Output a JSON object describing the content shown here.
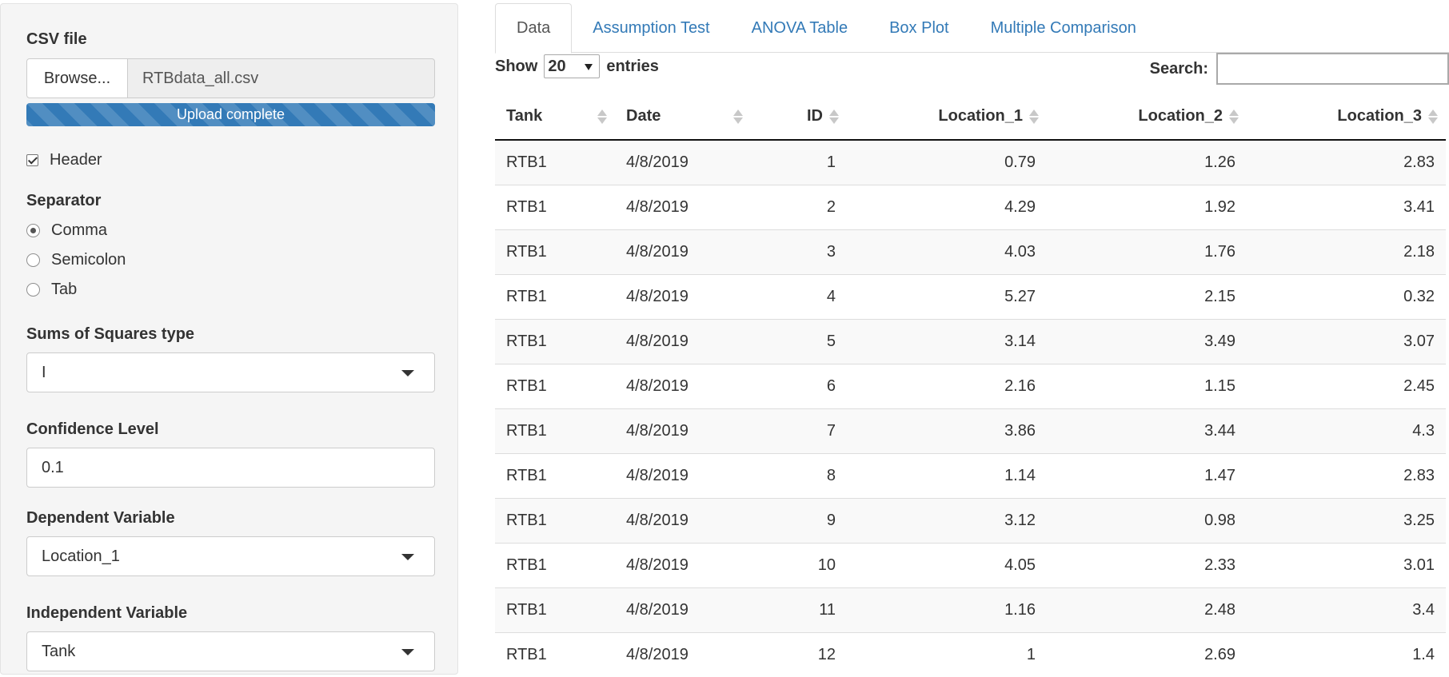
{
  "sidebar": {
    "csv_label": "CSV file",
    "browse_label": "Browse...",
    "file_name": "RTBdata_all.csv",
    "upload_status": "Upload complete",
    "upload_progress_percent": 100,
    "header_label": "Header",
    "header_checked": true,
    "separator_label": "Separator",
    "separator_options": [
      {
        "label": "Comma",
        "checked": true
      },
      {
        "label": "Semicolon",
        "checked": false
      },
      {
        "label": "Tab",
        "checked": false
      }
    ],
    "ss_type_label": "Sums of Squares type",
    "ss_type_value": "I",
    "confidence_label": "Confidence Level",
    "confidence_value": "0.1",
    "dependent_label": "Dependent Variable",
    "dependent_value": "Location_1",
    "independent_label": "Independent Variable",
    "independent_value": "Tank"
  },
  "tabs": [
    {
      "label": "Data",
      "active": true
    },
    {
      "label": "Assumption Test",
      "active": false
    },
    {
      "label": "ANOVA Table",
      "active": false
    },
    {
      "label": "Box Plot",
      "active": false
    },
    {
      "label": "Multiple Comparison",
      "active": false
    }
  ],
  "table_controls": {
    "show_label": "Show",
    "entries_value": "20",
    "entries_label": "entries",
    "search_label": "Search:"
  },
  "table": {
    "columns": [
      "Tank",
      "Date",
      "ID",
      "Location_1",
      "Location_2",
      "Location_3"
    ],
    "rows": [
      [
        "RTB1",
        "4/8/2019",
        "1",
        "0.79",
        "1.26",
        "2.83"
      ],
      [
        "RTB1",
        "4/8/2019",
        "2",
        "4.29",
        "1.92",
        "3.41"
      ],
      [
        "RTB1",
        "4/8/2019",
        "3",
        "4.03",
        "1.76",
        "2.18"
      ],
      [
        "RTB1",
        "4/8/2019",
        "4",
        "5.27",
        "2.15",
        "0.32"
      ],
      [
        "RTB1",
        "4/8/2019",
        "5",
        "3.14",
        "3.49",
        "3.07"
      ],
      [
        "RTB1",
        "4/8/2019",
        "6",
        "2.16",
        "1.15",
        "2.45"
      ],
      [
        "RTB1",
        "4/8/2019",
        "7",
        "3.86",
        "3.44",
        "4.3"
      ],
      [
        "RTB1",
        "4/8/2019",
        "8",
        "1.14",
        "1.47",
        "2.83"
      ],
      [
        "RTB1",
        "4/8/2019",
        "9",
        "3.12",
        "0.98",
        "3.25"
      ],
      [
        "RTB1",
        "4/8/2019",
        "10",
        "4.05",
        "2.33",
        "3.01"
      ],
      [
        "RTB1",
        "4/8/2019",
        "11",
        "1.16",
        "2.48",
        "3.4"
      ],
      [
        "RTB1",
        "4/8/2019",
        "12",
        "1",
        "2.69",
        "1.4"
      ]
    ]
  }
}
